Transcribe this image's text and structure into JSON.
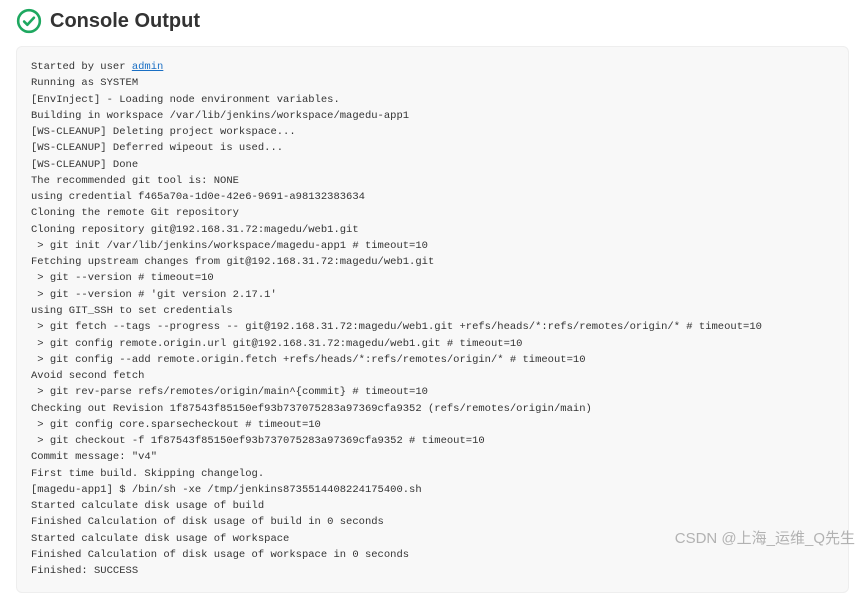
{
  "header": {
    "title": "Console Output",
    "status": "success"
  },
  "console": {
    "lines": [
      {
        "prefix": "Started by user ",
        "link": "admin",
        "suffix": ""
      },
      {
        "text": "Running as SYSTEM"
      },
      {
        "text": "[EnvInject] - Loading node environment variables."
      },
      {
        "text": "Building in workspace /var/lib/jenkins/workspace/magedu-app1"
      },
      {
        "text": "[WS-CLEANUP] Deleting project workspace..."
      },
      {
        "text": "[WS-CLEANUP] Deferred wipeout is used..."
      },
      {
        "text": "[WS-CLEANUP] Done"
      },
      {
        "text": "The recommended git tool is: NONE"
      },
      {
        "text": "using credential f465a70a-1d0e-42e6-9691-a98132383634"
      },
      {
        "text": "Cloning the remote Git repository"
      },
      {
        "text": "Cloning repository git@192.168.31.72:magedu/web1.git"
      },
      {
        "text": " > git init /var/lib/jenkins/workspace/magedu-app1 # timeout=10"
      },
      {
        "text": "Fetching upstream changes from git@192.168.31.72:magedu/web1.git"
      },
      {
        "text": " > git --version # timeout=10"
      },
      {
        "text": " > git --version # 'git version 2.17.1'"
      },
      {
        "text": "using GIT_SSH to set credentials "
      },
      {
        "text": " > git fetch --tags --progress -- git@192.168.31.72:magedu/web1.git +refs/heads/*:refs/remotes/origin/* # timeout=10"
      },
      {
        "text": " > git config remote.origin.url git@192.168.31.72:magedu/web1.git # timeout=10"
      },
      {
        "text": " > git config --add remote.origin.fetch +refs/heads/*:refs/remotes/origin/* # timeout=10"
      },
      {
        "text": "Avoid second fetch"
      },
      {
        "text": " > git rev-parse refs/remotes/origin/main^{commit} # timeout=10"
      },
      {
        "text": "Checking out Revision 1f87543f85150ef93b737075283a97369cfa9352 (refs/remotes/origin/main)"
      },
      {
        "text": " > git config core.sparsecheckout # timeout=10"
      },
      {
        "text": " > git checkout -f 1f87543f85150ef93b737075283a97369cfa9352 # timeout=10"
      },
      {
        "text": "Commit message: \"v4\""
      },
      {
        "text": "First time build. Skipping changelog."
      },
      {
        "text": "[magedu-app1] $ /bin/sh -xe /tmp/jenkins8735514408224175400.sh"
      },
      {
        "text": "Started calculate disk usage of build"
      },
      {
        "text": "Finished Calculation of disk usage of build in 0 seconds"
      },
      {
        "text": "Started calculate disk usage of workspace"
      },
      {
        "text": "Finished Calculation of disk usage of workspace in 0 seconds"
      },
      {
        "text": "Finished: SUCCESS"
      }
    ]
  },
  "watermark": "CSDN @上海_运维_Q先生"
}
